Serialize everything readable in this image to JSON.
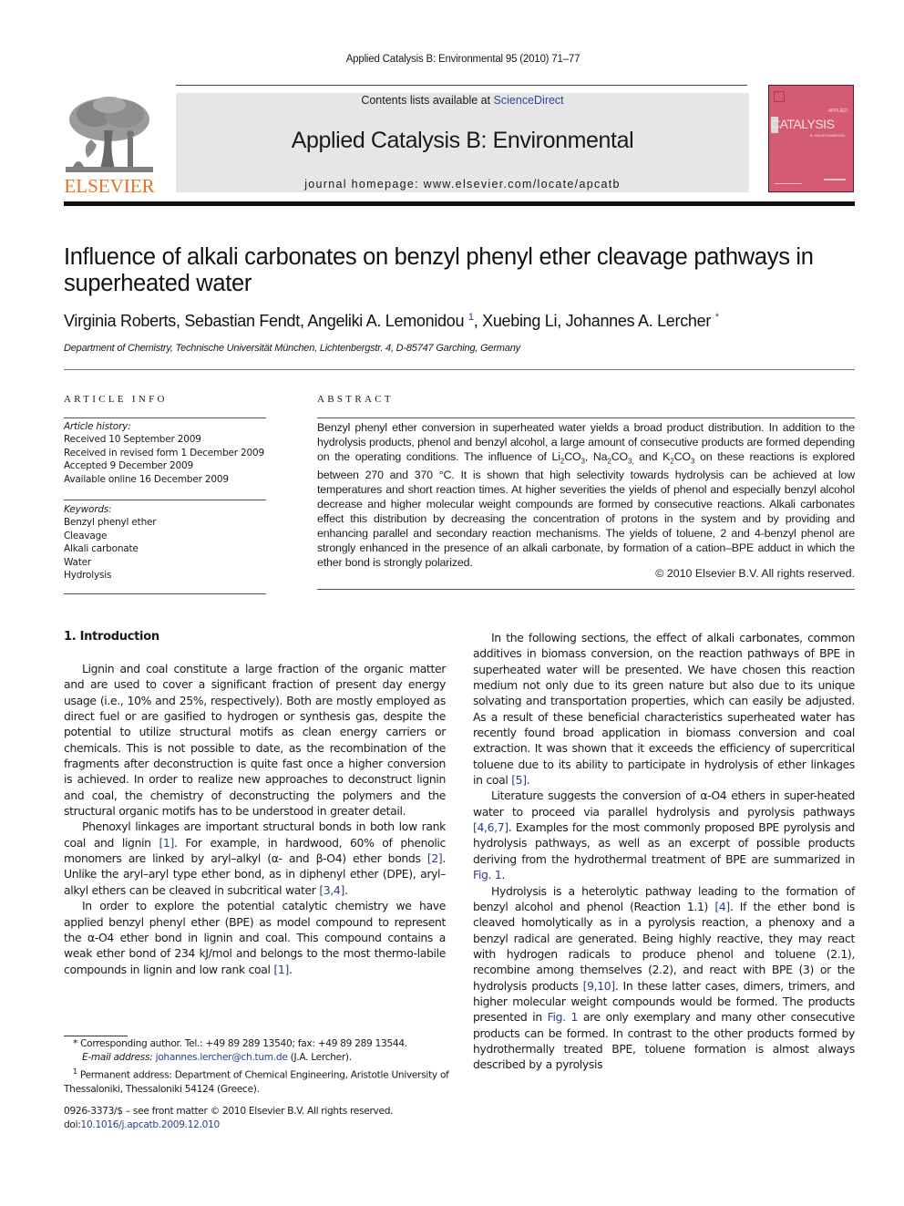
{
  "header": {
    "running_head": "Applied Catalysis B: Environmental 95 (2010) 71–77",
    "contents_prefix": "Contents lists available at ",
    "contents_link": "ScienceDirect",
    "journal_name": "Applied Catalysis B: Environmental",
    "homepage": "journal homepage: www.elsevier.com/locate/apcatb",
    "publisher_logo_icon": "elsevier-tree-logo",
    "publisher_name": "ELSEVIER",
    "cover": {
      "small_label": "APPLIED",
      "title": "CATALYSIS",
      "subtitle": "B: ENVIRONMENTAL",
      "color": "#d45b72"
    },
    "colors": {
      "elsevier_orange": "#e9711c",
      "link_blue": "#2a3d8f",
      "banner_gray": "#e6e6e6"
    }
  },
  "article": {
    "title": "Influence of alkali carbonates on benzyl phenyl ether cleavage pathways in superheated water",
    "authors": [
      {
        "name": "Virginia Roberts",
        "mark": ""
      },
      {
        "name": "Sebastian Fendt",
        "mark": ""
      },
      {
        "name": "Angeliki A. Lemonidou",
        "mark": "1"
      },
      {
        "name": "Xuebing Li",
        "mark": ""
      },
      {
        "name": "Johannes A. Lercher",
        "mark": "*"
      }
    ],
    "affiliation": "Department of Chemistry, Technische Universität München, Lichtenbergstr. 4, D-85747 Garching, Germany"
  },
  "article_info": {
    "heading": "ARTICLE INFO",
    "history_label": "Article history:",
    "history": [
      "Received 10 September 2009",
      "Received in revised form 1 December 2009",
      "Accepted 9 December 2009",
      "Available online 16 December 2009"
    ],
    "keywords_label": "Keywords:",
    "keywords": [
      "Benzyl phenyl ether",
      "Cleavage",
      "Alkali carbonate",
      "Water",
      "Hydrolysis"
    ]
  },
  "abstract": {
    "heading": "ABSTRACT",
    "parts": {
      "p1": "Benzyl phenyl ether conversion in superheated water yields a broad product distribution. In addition to the hydrolysis products, phenol and benzyl alcohol, a large amount of consecutive products are formed depending on the operating conditions. The influence of Li",
      "s1": "2",
      "p2": "CO",
      "s2": "3",
      "p3": ", Na",
      "s3": "2",
      "p4": "CO",
      "s4": "3,",
      "p5": " and K",
      "s5": "2",
      "p6": "CO",
      "s6": "3",
      "p7": " on these reactions is explored between 270 and 370 °C. It is shown that high selectivity towards hydrolysis can be achieved at low temperatures and short reaction times. At higher severities the yields of phenol and especially benzyl alcohol decrease and higher molecular weight compounds are formed by consecutive reactions. Alkali carbonates effect this distribution by decreasing the concentration of protons in the system and by providing and enhancing parallel and secondary reaction mechanisms. The yields of toluene, 2 and 4-benzyl phenol are strongly enhanced in the presence of an alkali carbonate, by formation of a cation–BPE adduct in which the ether bond is strongly polarized."
    },
    "copyright": "© 2010 Elsevier B.V. All rights reserved."
  },
  "body": {
    "section_heading": "1.  Introduction",
    "left": {
      "p1": "Lignin and coal constitute a large fraction of the organic matter and are used to cover a significant fraction of present day energy usage (i.e., 10% and 25%, respectively). Both are mostly employed as direct fuel or are gasified to hydrogen or synthesis gas, despite the potential to utilize structural motifs as clean energy carriers or chemicals. This is not possible to date, as the recombination of the fragments after deconstruction is quite fast once a higher conversion is achieved. In order to realize new approaches to deconstruct lignin and coal, the chemistry of deconstructing the polymers and the structural organic motifs has to be understood in greater detail.",
      "p2a": "Phenoxyl linkages are important structural bonds in both low rank coal and lignin ",
      "p2_ref1": "[1]",
      "p2b": ". For example, in hardwood, 60% of phenolic monomers are linked by aryl–alkyl (α- and β-O4) ether bonds ",
      "p2_ref2": "[2]",
      "p2c": ". Unlike the aryl–aryl type ether bond, as in diphenyl ether (DPE), aryl–alkyl ethers can be cleaved in subcritical water ",
      "p2_ref3": "[3,4]",
      "p2d": ".",
      "p3a": "In order to explore the potential catalytic chemistry we have applied benzyl phenyl ether (BPE) as model compound to represent the α-O4 ether bond in lignin and coal. This compound contains a weak ether bond of 234 kJ/mol and belongs to the most thermo-labile compounds in lignin and low rank coal ",
      "p3_ref1": "[1]",
      "p3b": "."
    },
    "right": {
      "p1a": "In the following sections, the effect of alkali carbonates, common additives in biomass conversion, on the reaction pathways of BPE in superheated water will be presented. We have chosen this reaction medium not only due to its green nature but also due to its unique solvating and transportation properties, which can easily be adjusted. As a result of these beneficial characteristics superheated water has recently found broad application in biomass conversion and coal extraction. It was shown that it exceeds the efficiency of supercritical toluene due to its ability to participate in hydrolysis of ether linkages in coal ",
      "p1_ref1": "[5]",
      "p1b": ".",
      "p2a": "Literature suggests the conversion of α-O4 ethers in super-heated water to proceed via parallel hydrolysis and pyrolysis pathways ",
      "p2_ref1": "[4,6,7]",
      "p2b": ". Examples for the most commonly proposed BPE pyrolysis and hydrolysis pathways, as well as an excerpt of possible products deriving from the hydrothermal treatment of BPE are summarized in ",
      "p2_ref2": "Fig. 1",
      "p2c": ".",
      "p3a": "Hydrolysis is a heterolytic pathway leading to the formation of benzyl alcohol and phenol (Reaction 1.1) ",
      "p3_ref1": "[4]",
      "p3b": ". If the ether bond is cleaved homolytically as in a pyrolysis reaction, a phenoxy and a benzyl radical are generated. Being highly reactive, they may react with hydrogen radicals to produce phenol and toluene (2.1), recombine among themselves (2.2), and react with BPE (3) or the hydrolysis products ",
      "p3_ref2": "[9,10]",
      "p3c": ". In these latter cases, dimers, trimers, and higher molecular weight compounds would be formed. The products presented in ",
      "p3_ref3": "Fig. 1",
      "p3d": " are only exemplary and many other consecutive products can be formed. In contrast to the other products formed by hydrothermally treated BPE, toluene formation is almost always described by a pyrolysis"
    }
  },
  "footnotes": {
    "star_mark": "*",
    "corresponding": " Corresponding author. Tel.: +49 89 289 13540; fax: +49 89 289 13544.",
    "email_label": "E-mail address: ",
    "email": "johannes.lercher@ch.tum.de",
    "email_suffix": " (J.A. Lercher).",
    "one_mark": "1",
    "permanent": " Permanent address: Department of Chemical Engineering, Aristotle University of Thessaloniki, Thessaloniki 54124 (Greece).",
    "front_matter": "0926-3373/$ – see front matter © 2010 Elsevier B.V. All rights reserved.",
    "doi_label": "doi:",
    "doi": "10.1016/j.apcatb.2009.12.010"
  }
}
